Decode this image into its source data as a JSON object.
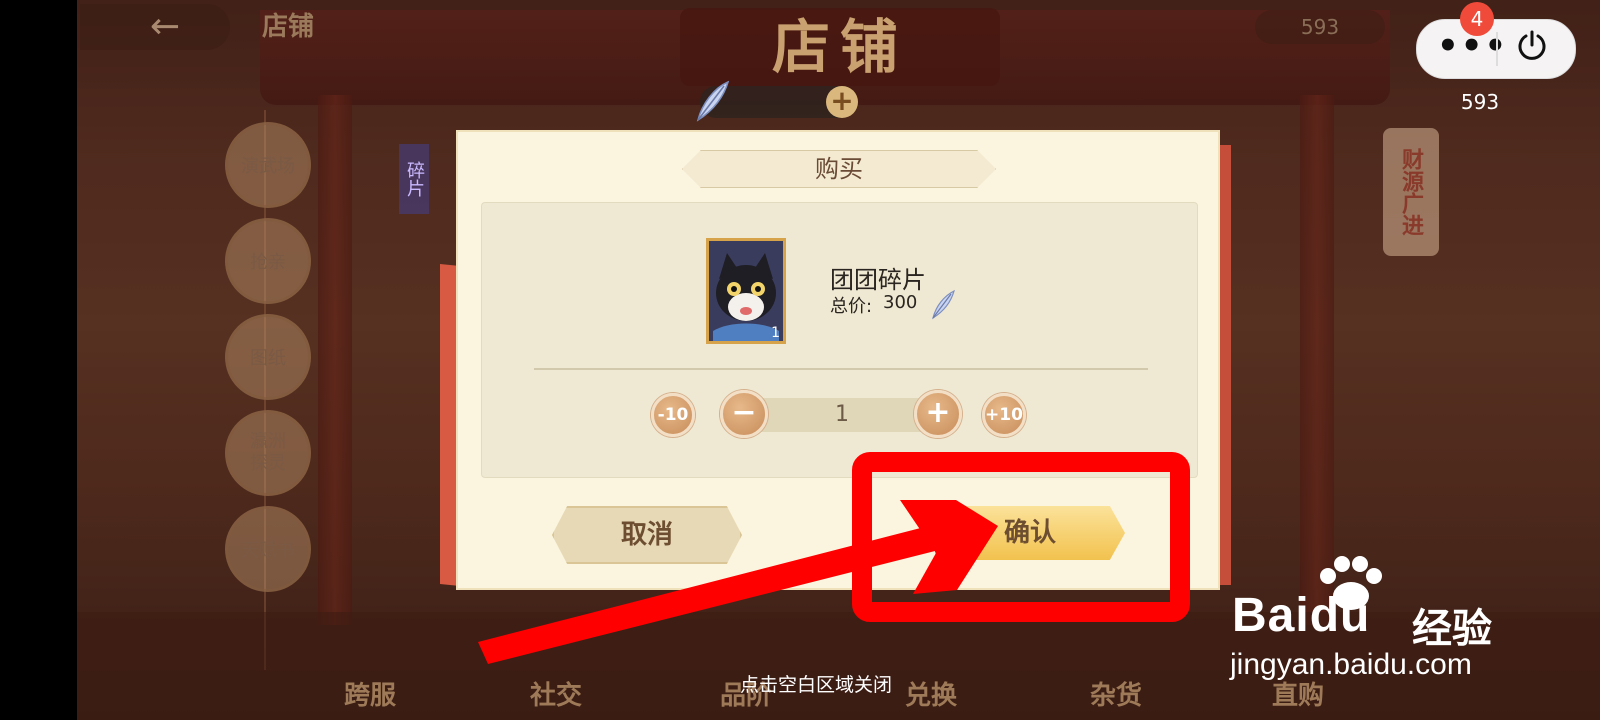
{
  "header": {
    "back_label": "店铺",
    "title": "店铺",
    "currency_top": "593"
  },
  "system_menu": {
    "badge_count": "4",
    "more_icon": "more-dots-icon",
    "power_icon": "power-icon"
  },
  "currency": {
    "amount": "593",
    "icon": "feather-icon"
  },
  "sidebar": {
    "items": [
      {
        "label": "演武场"
      },
      {
        "label": "抢亲"
      },
      {
        "label": "图纸"
      },
      {
        "label": "瀛洲\n探灵"
      },
      {
        "label": "天赋书"
      }
    ]
  },
  "side_tabs": {
    "fragment": "碎片",
    "banner": "财源广进"
  },
  "dialog": {
    "title": "购买",
    "item": {
      "name": "团团碎片",
      "price_label": "总价:",
      "price": "300",
      "icon_qty": "1"
    },
    "quantity": {
      "value": "1",
      "minus10": "-10",
      "minus": "−",
      "plus": "+",
      "plus10": "+10"
    },
    "cancel_label": "取消",
    "confirm_label": "确认"
  },
  "bottom_nav": [
    {
      "label": "跨服"
    },
    {
      "label": "社交"
    },
    {
      "label": "品阶"
    },
    {
      "label": "兑换"
    },
    {
      "label": "杂货"
    },
    {
      "label": "直购"
    }
  ],
  "close_hint": "点击空白区域关闭",
  "watermark": {
    "brand": "Baidu",
    "cn": "经验",
    "url": "jingyan.baidu.com"
  },
  "colors": {
    "annotation": "#ff0000",
    "confirm": "#f2c24e",
    "panel": "#fbf4de"
  }
}
